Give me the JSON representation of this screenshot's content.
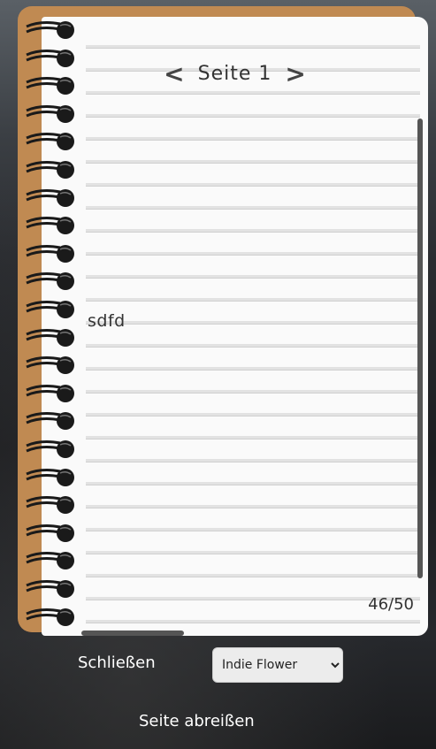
{
  "notebook": {
    "prev_label": "<",
    "title": "Seite 1",
    "next_label": ">",
    "content": "sdfd",
    "counter": "46/50"
  },
  "controls": {
    "close_label": "Schließen",
    "font_selected": "Indie Flower",
    "tear_label": "Seite abreißen"
  },
  "colors": {
    "cover": "#c08a52",
    "paper": "#fafafa",
    "rings": "#1a1a1a"
  }
}
